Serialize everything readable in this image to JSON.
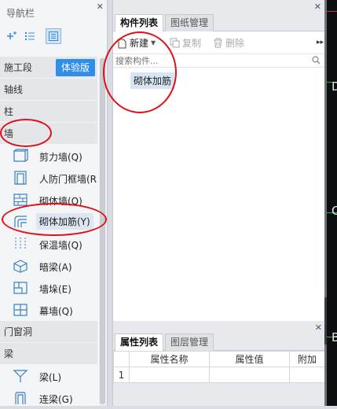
{
  "nav": {
    "title": "导航栏",
    "close": "✕",
    "categories": {
      "stage": "施工段",
      "stage_badge": "体验版",
      "axis": "轴线",
      "column": "柱",
      "wall": "墙",
      "opening": "门窗洞",
      "beam": "梁"
    },
    "wall_items": [
      {
        "label": "剪力墙(Q)",
        "icon": "shear-wall-icon"
      },
      {
        "label": "人防门框墙(R",
        "icon": "civil-defense-door-wall-icon"
      },
      {
        "label": "砌体墙(Q)",
        "icon": "masonry-wall-icon"
      },
      {
        "label": "砌体加筋(Y)",
        "icon": "masonry-rebar-icon"
      },
      {
        "label": "保温墙(Q)",
        "icon": "insulation-wall-icon"
      },
      {
        "label": "暗梁(A)",
        "icon": "hidden-beam-icon"
      },
      {
        "label": "墙垛(E)",
        "icon": "wall-pier-icon"
      },
      {
        "label": "幕墙(Q)",
        "icon": "curtain-wall-icon"
      }
    ],
    "beam_items": [
      {
        "label": "梁(L)",
        "icon": "beam-icon"
      },
      {
        "label": "连梁(G)",
        "icon": "coupling-beam-icon"
      }
    ]
  },
  "components": {
    "close": "✕",
    "tabs": [
      "构件列表",
      "图纸管理"
    ],
    "toolbar": {
      "new": "新建",
      "copy": "复制",
      "delete": "删除",
      "more": "▸▸"
    },
    "search_placeholder": "搜索构件...",
    "tree_items": [
      "砌体加筋"
    ]
  },
  "properties": {
    "close": "✕",
    "tabs": [
      "属性列表",
      "图层管理"
    ],
    "columns": [
      "属性名称",
      "属性值",
      "附加"
    ],
    "rows": [
      {
        "index": "1",
        "name": "",
        "value": "",
        "extra": ""
      }
    ]
  },
  "canvas": {
    "labels": [
      "D",
      "C",
      "B"
    ]
  },
  "colors": {
    "accent": "#2f8fe8",
    "annotation": "#e0101a",
    "canvas_bg": "#0b0f12",
    "grid_green": "#3fae3f"
  }
}
